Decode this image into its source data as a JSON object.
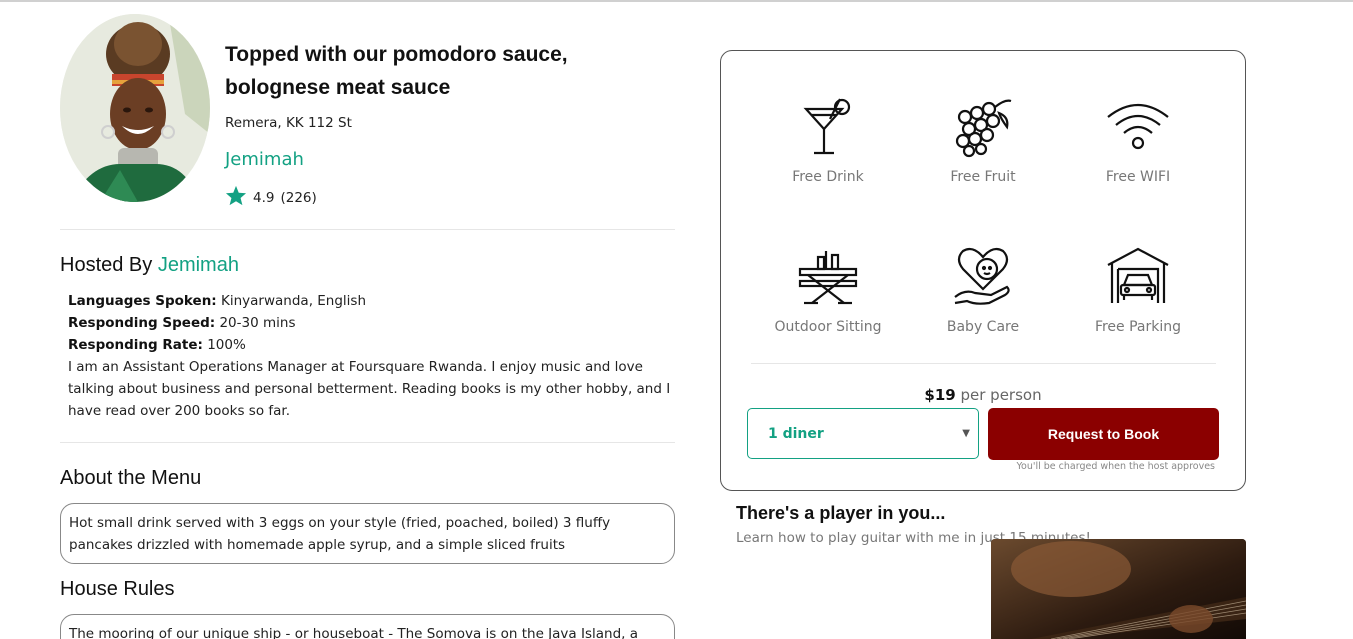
{
  "experience": {
    "title": "Topped with our pomodoro sauce, bolognese meat sauce",
    "address": "Remera, KK 112 St",
    "host_name": "Jemimah",
    "rating": "4.9",
    "reviews": "(226)"
  },
  "hosted_by": {
    "prefix": "Hosted By ",
    "name": "Jemimah",
    "languages_label": "Languages Spoken:",
    "languages_value": " Kinyarwanda, English",
    "speed_label": "Responding Speed:",
    "speed_value": " 20-30 mins",
    "rate_label": "Responding Rate:",
    "rate_value": " 100%",
    "bio": "I am an Assistant Operations Manager at Foursquare Rwanda. I enjoy music and love talking about business and personal betterment. Reading books is my other hobby, and I have read over 200 books so far."
  },
  "menu": {
    "heading": "About the Menu",
    "text": "Hot small drink served with 3 eggs on your style (fried, poached, boiled) 3 fluffy pancakes drizzled with homemade apple syrup, and a simple sliced fruits"
  },
  "rules": {
    "heading": "House Rules",
    "text": "The mooring of our unique ship - or houseboat - The Somova is on the Java Island, a"
  },
  "amenities": [
    {
      "label": "Free Drink",
      "icon": "cocktail-icon"
    },
    {
      "label": "Free Fruit",
      "icon": "grapes-icon"
    },
    {
      "label": "Free WIFI",
      "icon": "wifi-icon"
    },
    {
      "label": "Outdoor Sitting",
      "icon": "picnic-table-icon"
    },
    {
      "label": "Baby Care",
      "icon": "baby-care-icon"
    },
    {
      "label": "Free Parking",
      "icon": "garage-icon"
    }
  ],
  "booking": {
    "price": "$19",
    "price_suffix": " per person",
    "diners": "1 diner",
    "button": "Request to Book",
    "note": "You'll be charged when the host approves"
  },
  "promo": {
    "title": "There's a player in you...",
    "subtitle": "Learn how to play guitar with me in just 15 minutes!"
  },
  "colors": {
    "accent": "#13a183",
    "book_button": "#8b0000"
  }
}
